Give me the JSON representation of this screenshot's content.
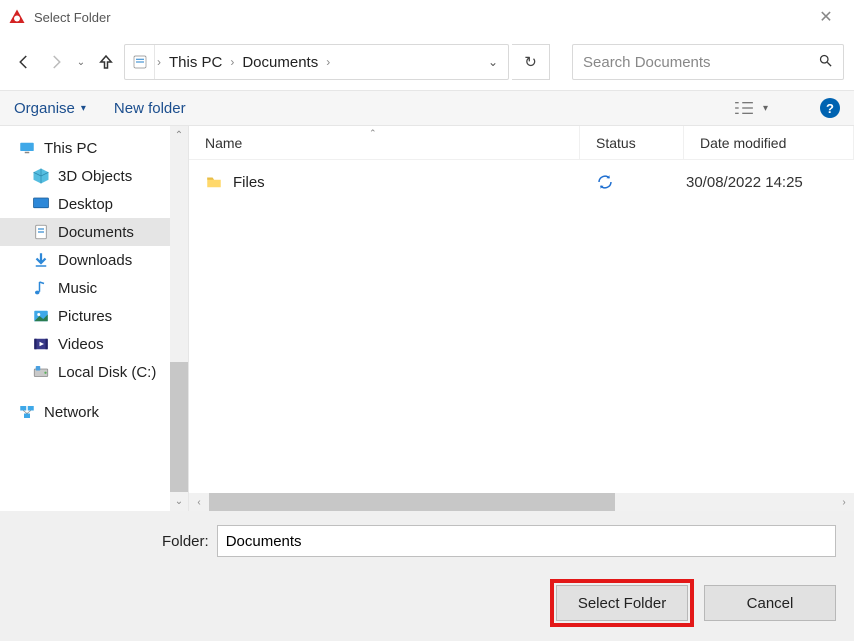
{
  "titlebar": {
    "title": "Select Folder"
  },
  "breadcrumb": {
    "seg1": "This PC",
    "seg2": "Documents"
  },
  "search": {
    "placeholder": "Search Documents"
  },
  "toolbar": {
    "organise": "Organise",
    "new_folder": "New folder",
    "help": "?"
  },
  "tree": {
    "root": "This PC",
    "items": [
      {
        "label": "3D Objects",
        "icon": "cube-icon"
      },
      {
        "label": "Desktop",
        "icon": "desktop-icon"
      },
      {
        "label": "Documents",
        "icon": "document-icon",
        "selected": true
      },
      {
        "label": "Downloads",
        "icon": "download-icon"
      },
      {
        "label": "Music",
        "icon": "music-icon"
      },
      {
        "label": "Pictures",
        "icon": "pictures-icon"
      },
      {
        "label": "Videos",
        "icon": "videos-icon"
      },
      {
        "label": "Local Disk (C:)",
        "icon": "disk-icon"
      }
    ],
    "network": "Network"
  },
  "list": {
    "columns": {
      "name": "Name",
      "status": "Status",
      "date": "Date modified"
    },
    "rows": [
      {
        "name": "Files",
        "status_icon": "sync-icon",
        "date": "30/08/2022 14:25"
      }
    ]
  },
  "bottom": {
    "folder_label": "Folder:",
    "folder_value": "Documents",
    "select_btn": "Select Folder",
    "cancel_btn": "Cancel"
  }
}
